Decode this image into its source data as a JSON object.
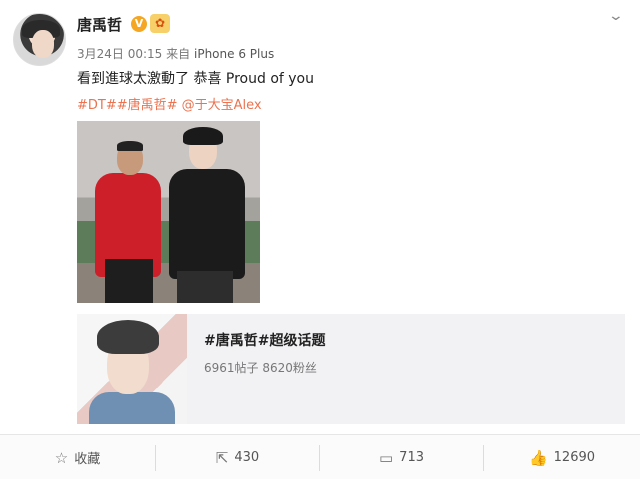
{
  "post": {
    "username": "唐禹哲",
    "verified_badge": "V",
    "member_badge": "✿",
    "date": "3月24日",
    "time": "00:15",
    "source_prefix": "来自",
    "source": "iPhone 6 Plus",
    "content": "看到進球太激動了 恭喜 Proud of you",
    "tags": "#DT##唐禹哲# @于大宝Alex"
  },
  "topic_card": {
    "title": "#唐禹哲#超级话题",
    "stats": "6961帖子 8620粉丝"
  },
  "actions": {
    "favorite_label": "收藏",
    "repost_count": "430",
    "comment_count": "713",
    "like_count": "12690"
  },
  "icons": {
    "favorite": "star-icon",
    "repost": "share-icon",
    "comment": "comment-icon",
    "like": "thumbs-up-icon",
    "menu": "chevron-down-icon"
  },
  "colors": {
    "tag_link": "#eb7350",
    "verified": "#f5a623",
    "card_bg": "#f2f2f5"
  }
}
